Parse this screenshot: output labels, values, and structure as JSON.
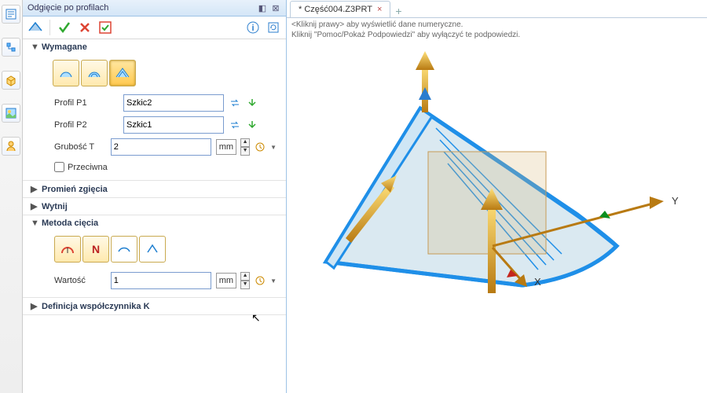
{
  "panel": {
    "title": "Odgięcie po profilach"
  },
  "sections": {
    "required": {
      "header": "Wymagane",
      "profile1_label": "Profil P1",
      "profile1_value": "Szkic2",
      "profile2_label": "Profil P2",
      "profile2_value": "Szkic1",
      "thickness_label": "Grubość T",
      "thickness_value": "2",
      "thickness_unit": "mm",
      "opposite_label": "Przeciwna"
    },
    "bend_radius": {
      "header": "Promień zgięcia"
    },
    "extend": {
      "header": "Wytnij"
    },
    "cut_method": {
      "header": "Metoda cięcia",
      "value_label": "Wartość",
      "value": "1",
      "value_unit": "mm"
    },
    "k_factor": {
      "header": "Definicja współczynnika K"
    }
  },
  "viewport": {
    "tab_label": "* Część004.Z3PRT",
    "hint1": "<Kliknij prawy> aby wyświetlić dane numeryczne.",
    "hint2": "Kliknij \"Pomoc/Pokaż Podpowiedzi\" aby wyłączyć te podpowiedzi.",
    "axis_x": "X",
    "axis_y": "Y"
  },
  "colors": {
    "model_edge": "#1f8fe8",
    "model_face": "#bcd7e6",
    "axis": "#d9a21e",
    "plane": "#d0a060"
  }
}
